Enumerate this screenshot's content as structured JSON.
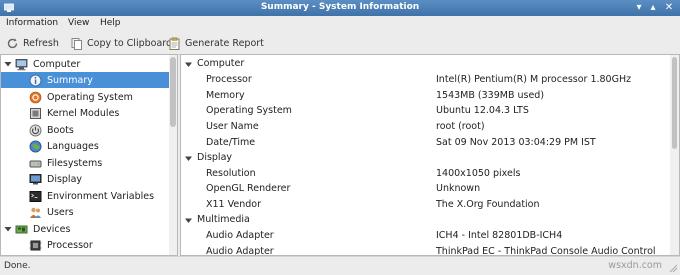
{
  "window": {
    "title": "Summary - System Information"
  },
  "menubar": {
    "items": [
      {
        "label": "Information"
      },
      {
        "label": "View"
      },
      {
        "label": "Help"
      }
    ]
  },
  "toolbar": {
    "refresh_label": "Refresh",
    "copy_label": "Copy to Clipboard",
    "report_label": "Generate Report"
  },
  "tree": {
    "items": [
      {
        "label": "Computer",
        "icon": "computer-icon"
      },
      {
        "label": "Summary",
        "icon": "info-icon"
      },
      {
        "label": "Operating System",
        "icon": "os-icon"
      },
      {
        "label": "Kernel Modules",
        "icon": "modules-icon"
      },
      {
        "label": "Boots",
        "icon": "power-icon"
      },
      {
        "label": "Languages",
        "icon": "languages-icon"
      },
      {
        "label": "Filesystems",
        "icon": "filesystems-icon"
      },
      {
        "label": "Display",
        "icon": "display-icon"
      },
      {
        "label": "Environment Variables",
        "icon": "environment-icon"
      },
      {
        "label": "Users",
        "icon": "users-icon"
      },
      {
        "label": "Devices",
        "icon": "devices-icon"
      },
      {
        "label": "Processor",
        "icon": "processor-icon"
      }
    ]
  },
  "details": {
    "rows": [
      {
        "key": "Computer",
        "value": ""
      },
      {
        "key": "Processor",
        "value": "Intel(R) Pentium(R) M processor 1.80GHz"
      },
      {
        "key": "Memory",
        "value": "1543MB (339MB used)"
      },
      {
        "key": "Operating System",
        "value": "Ubuntu 12.04.3 LTS"
      },
      {
        "key": "User Name",
        "value": "root (root)"
      },
      {
        "key": "Date/Time",
        "value": "Sat 09 Nov 2013 03:04:29 PM IST"
      },
      {
        "key": "Display",
        "value": ""
      },
      {
        "key": "Resolution",
        "value": "1400x1050 pixels"
      },
      {
        "key": "OpenGL Renderer",
        "value": "Unknown"
      },
      {
        "key": "X11 Vendor",
        "value": "The X.Org Foundation"
      },
      {
        "key": "Multimedia",
        "value": ""
      },
      {
        "key": "Audio Adapter",
        "value": "ICH4 - Intel 82801DB-ICH4"
      },
      {
        "key": "Audio Adapter",
        "value": "ThinkPad EC - ThinkPad Console Audio Control"
      }
    ]
  },
  "statusbar": {
    "text": "Done.",
    "watermark": "wsxdn.com"
  },
  "colors": {
    "titlebar": "#4a7fb8",
    "selection": "#4a90d9"
  }
}
